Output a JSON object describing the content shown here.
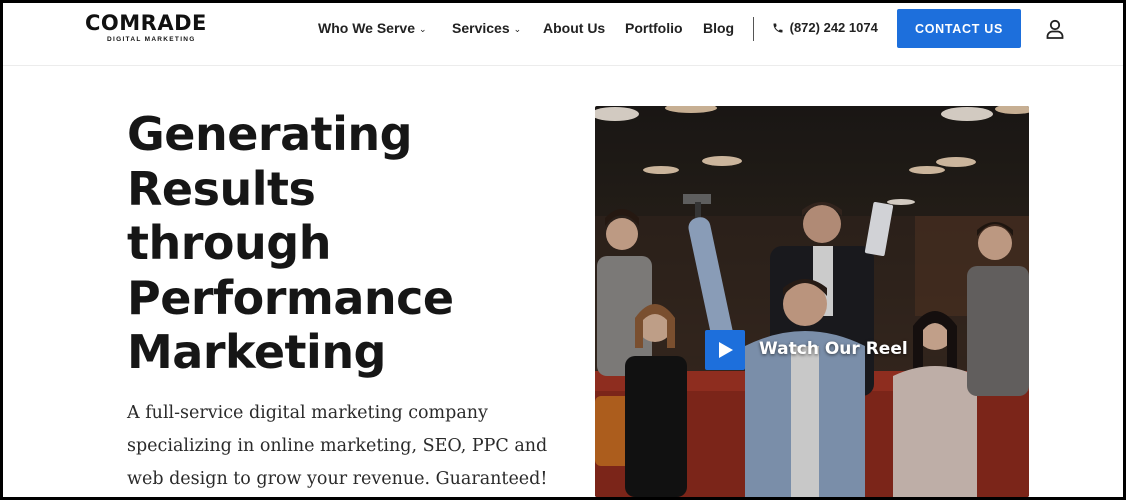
{
  "brand": {
    "name": "COMRADE",
    "tagline": "DIGITAL MARKETING"
  },
  "nav": {
    "items": [
      {
        "label": "Who We Serve",
        "has_dropdown": true
      },
      {
        "label": "Services",
        "has_dropdown": true
      },
      {
        "label": "About Us",
        "has_dropdown": false
      },
      {
        "label": "Portfolio",
        "has_dropdown": false
      },
      {
        "label": "Blog",
        "has_dropdown": false
      }
    ],
    "phone": "(872) 242 1074",
    "cta_label": "CONTACT US",
    "chevron": "⌄"
  },
  "hero": {
    "headline_lines": [
      "Generating",
      "Results",
      "through",
      "Performance",
      "Marketing"
    ],
    "subtext": "A full-service digital marketing company specializing in online marketing, SEO, PPC and web design to grow your revenue. Guaranteed!"
  },
  "video": {
    "label": "Watch Our Reel",
    "icon": "play-icon"
  },
  "colors": {
    "accent": "#1d6fdc",
    "text": "#161616"
  }
}
